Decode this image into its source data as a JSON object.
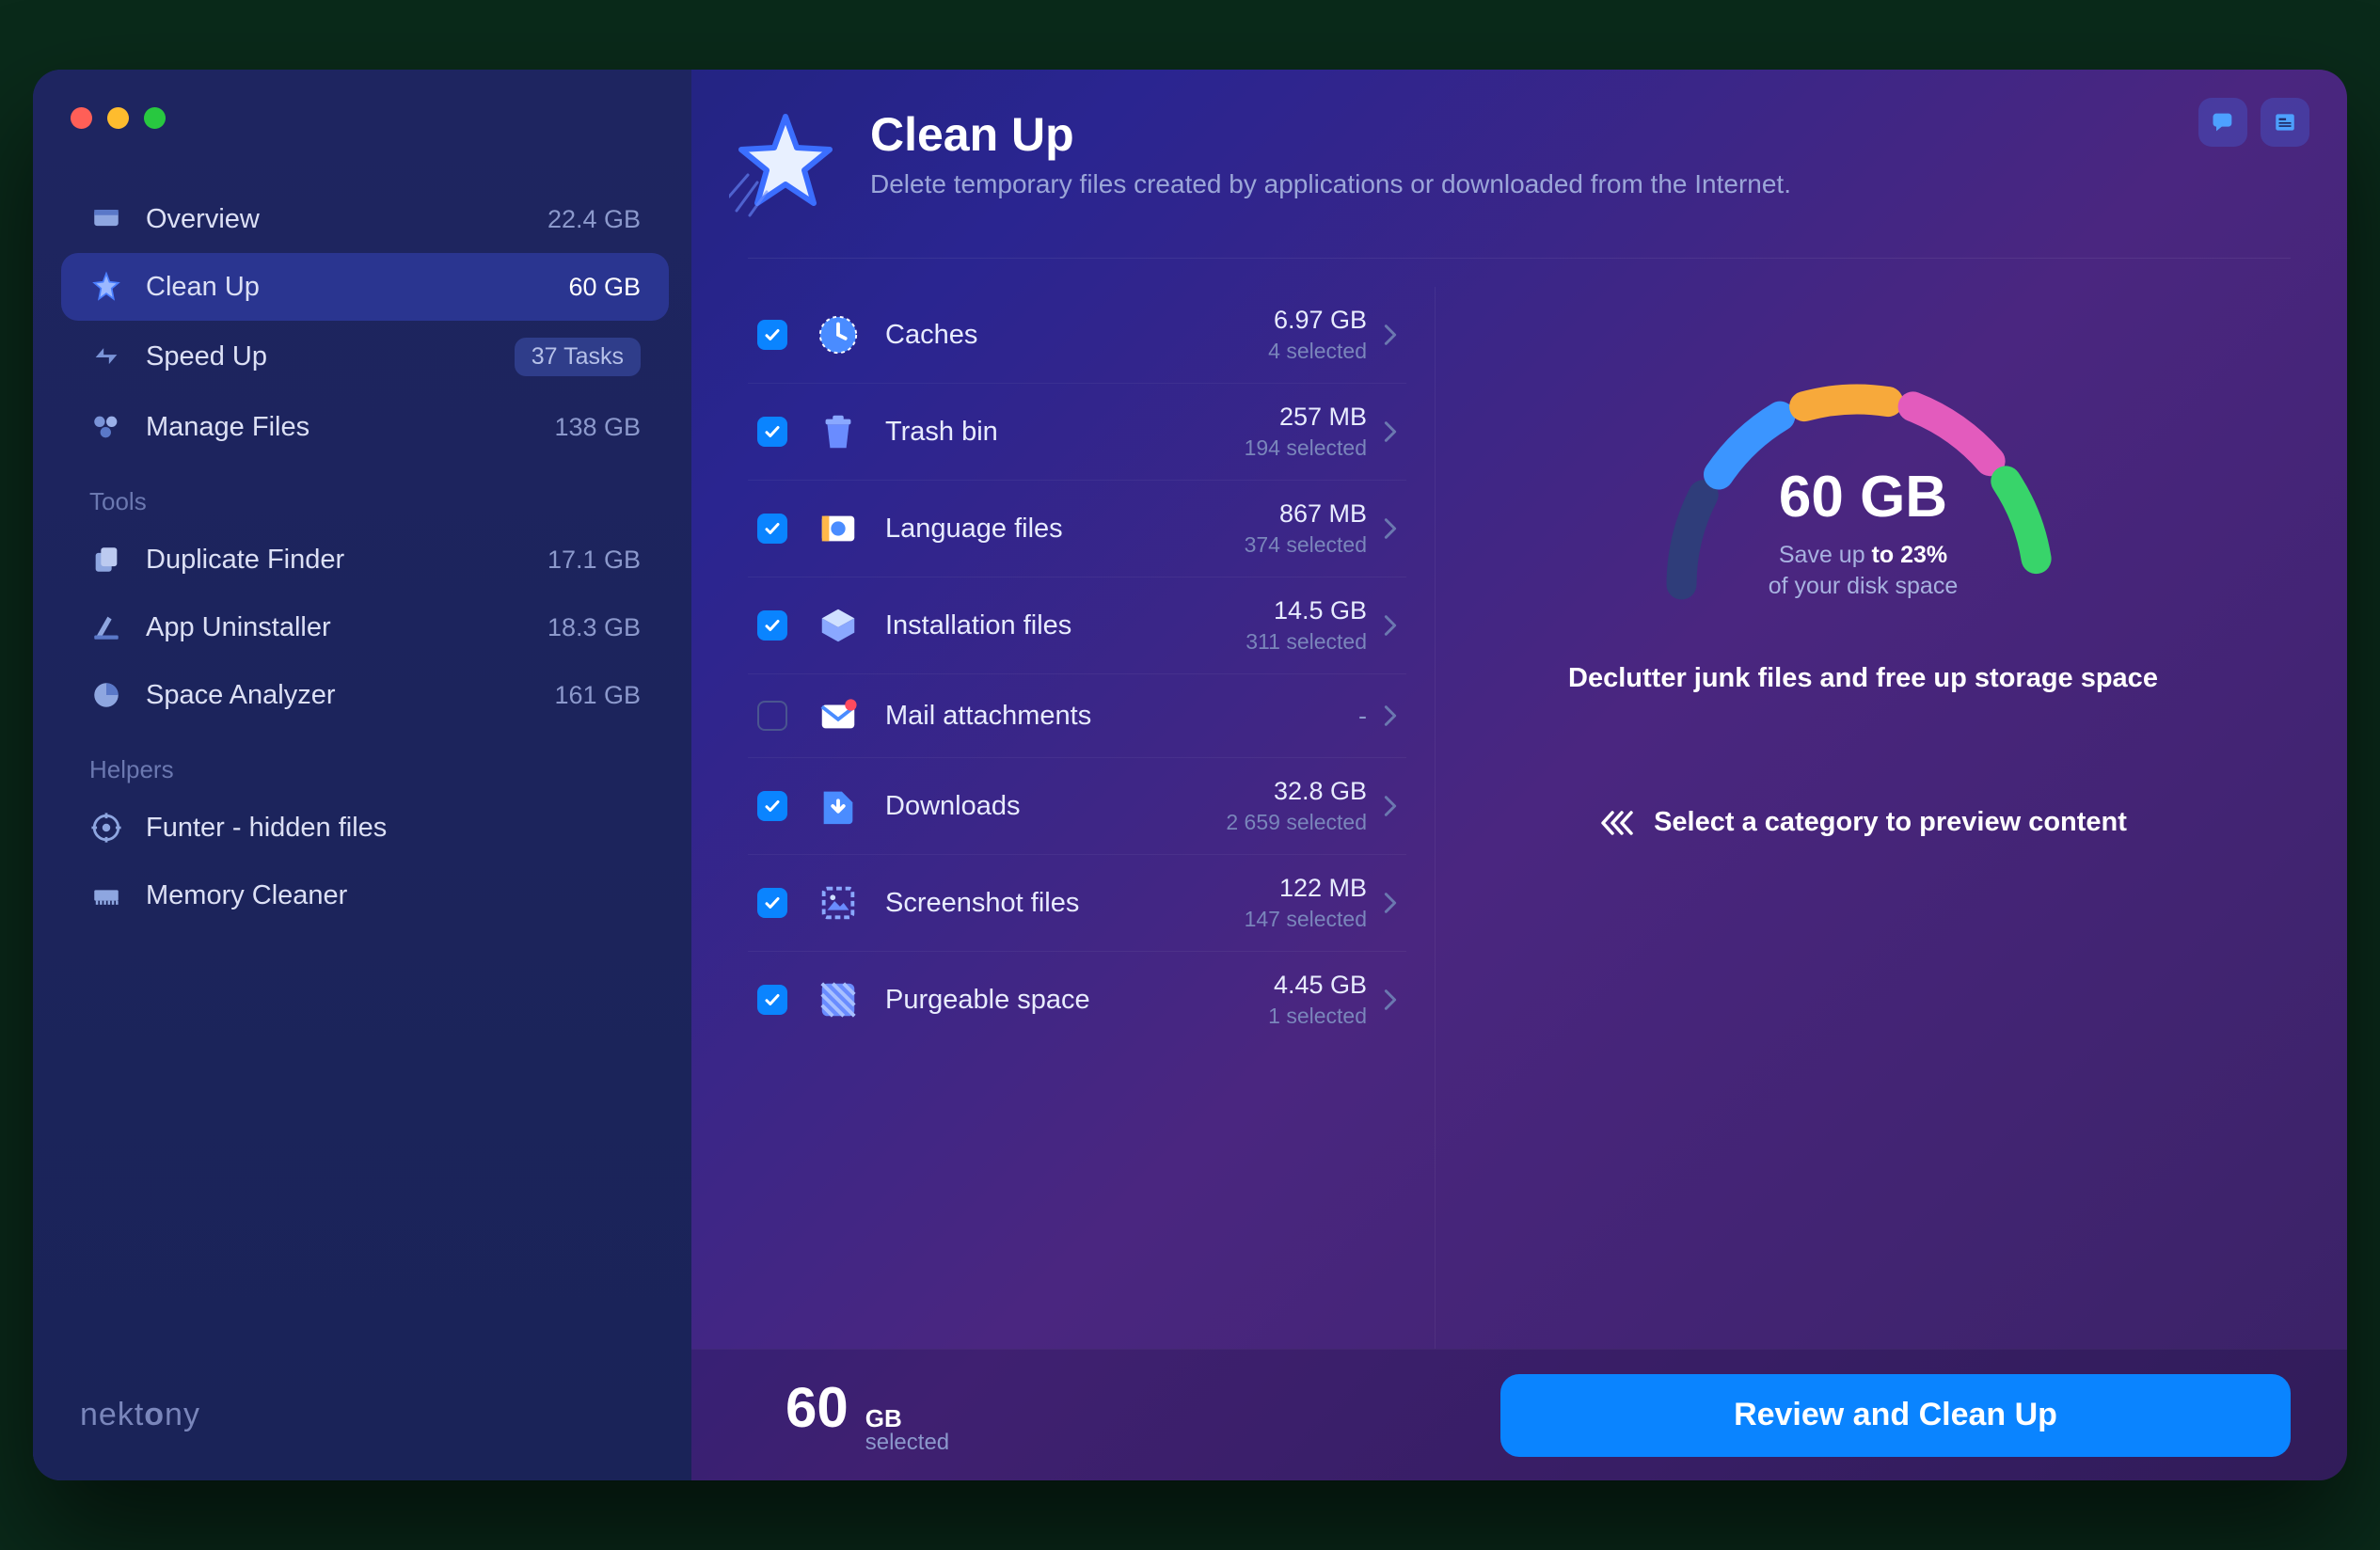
{
  "header": {
    "title": "Clean Up",
    "subtitle": "Delete temporary files created by applications or downloaded from the Internet."
  },
  "sidebar": {
    "main": [
      {
        "label": "Overview",
        "value": "22.4 GB",
        "icon": "overview-icon",
        "active": false
      },
      {
        "label": "Clean Up",
        "value": "60 GB",
        "icon": "cleanup-icon",
        "active": true
      },
      {
        "label": "Speed Up",
        "value": "37 Tasks",
        "icon": "speedup-icon",
        "badge": true,
        "active": false
      },
      {
        "label": "Manage Files",
        "value": "138 GB",
        "icon": "manage-icon",
        "active": false
      }
    ],
    "tools_header": "Tools",
    "tools": [
      {
        "label": "Duplicate Finder",
        "value": "17.1 GB",
        "icon": "duplicate-icon"
      },
      {
        "label": "App Uninstaller",
        "value": "18.3 GB",
        "icon": "uninstaller-icon"
      },
      {
        "label": "Space Analyzer",
        "value": "161 GB",
        "icon": "analyzer-icon"
      }
    ],
    "helpers_header": "Helpers",
    "helpers": [
      {
        "label": "Funter - hidden files",
        "icon": "funter-icon"
      },
      {
        "label": "Memory Cleaner",
        "icon": "memory-icon"
      }
    ],
    "brand": "nektony"
  },
  "categories": [
    {
      "name": "Caches",
      "size": "6.97 GB",
      "selected": "4 selected",
      "checked": true,
      "icon": "caches-icon"
    },
    {
      "name": "Trash bin",
      "size": "257 MB",
      "selected": "194 selected",
      "checked": true,
      "icon": "trash-icon"
    },
    {
      "name": "Language files",
      "size": "867 MB",
      "selected": "374 selected",
      "checked": true,
      "icon": "language-icon"
    },
    {
      "name": "Installation files",
      "size": "14.5 GB",
      "selected": "311 selected",
      "checked": true,
      "icon": "install-icon"
    },
    {
      "name": "Mail attachments",
      "size": "-",
      "selected": "",
      "checked": false,
      "icon": "mail-icon"
    },
    {
      "name": "Downloads",
      "size": "32.8 GB",
      "selected": "2 659 selected",
      "checked": true,
      "icon": "downloads-icon"
    },
    {
      "name": "Screenshot files",
      "size": "122 MB",
      "selected": "147 selected",
      "checked": true,
      "icon": "screenshot-icon"
    },
    {
      "name": "Purgeable space",
      "size": "4.45 GB",
      "selected": "1 selected",
      "checked": true,
      "icon": "purgeable-icon"
    }
  ],
  "gauge": {
    "value": "60 GB",
    "line1_prefix": "Save up ",
    "line1_bold": "to 23%",
    "line2": "of your disk space",
    "tagline": "Declutter junk files and free up storage space",
    "hint": "Select a category to preview content"
  },
  "footer": {
    "number": "60",
    "unit": "GB",
    "sub": "selected",
    "cta": "Review and Clean Up"
  }
}
